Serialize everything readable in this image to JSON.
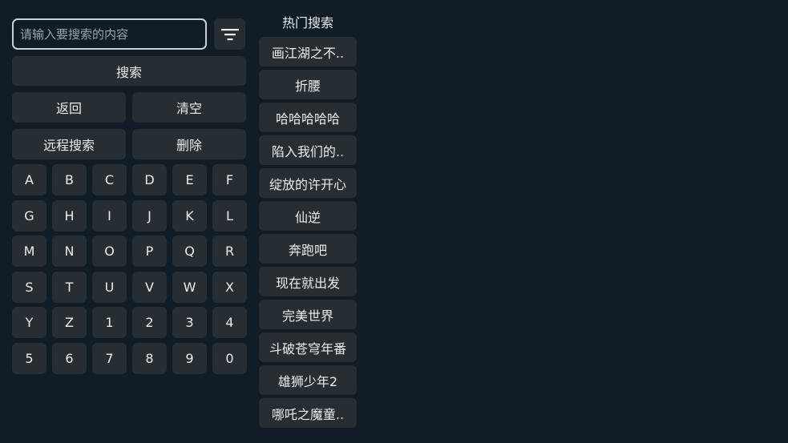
{
  "search": {
    "placeholder": "请输入要搜索的内容",
    "value": ""
  },
  "filter": {
    "icon": "filter-icon"
  },
  "actions": {
    "search_label": "搜索",
    "back_label": "返回",
    "clear_label": "清空",
    "remote_search_label": "远程搜索",
    "delete_label": "删除"
  },
  "keypad": {
    "keys": [
      "A",
      "B",
      "C",
      "D",
      "E",
      "F",
      "G",
      "H",
      "I",
      "J",
      "K",
      "L",
      "M",
      "N",
      "O",
      "P",
      "Q",
      "R",
      "S",
      "T",
      "U",
      "V",
      "W",
      "X",
      "Y",
      "Z",
      "1",
      "2",
      "3",
      "4",
      "5",
      "6",
      "7",
      "8",
      "9",
      "0"
    ]
  },
  "hot": {
    "title": "热门搜索",
    "items": [
      "画江湖之不..",
      "折腰",
      "哈哈哈哈哈",
      "陷入我们的..",
      "绽放的许开心",
      "仙逆",
      "奔跑吧",
      "现在就出发",
      "完美世界",
      "斗破苍穹年番",
      "雄狮少年2",
      "哪吒之魔童.."
    ]
  },
  "colors": {
    "background": "#121c25",
    "button": "#262d33",
    "text": "#e9edf0",
    "input_border": "#c9cfd4"
  }
}
